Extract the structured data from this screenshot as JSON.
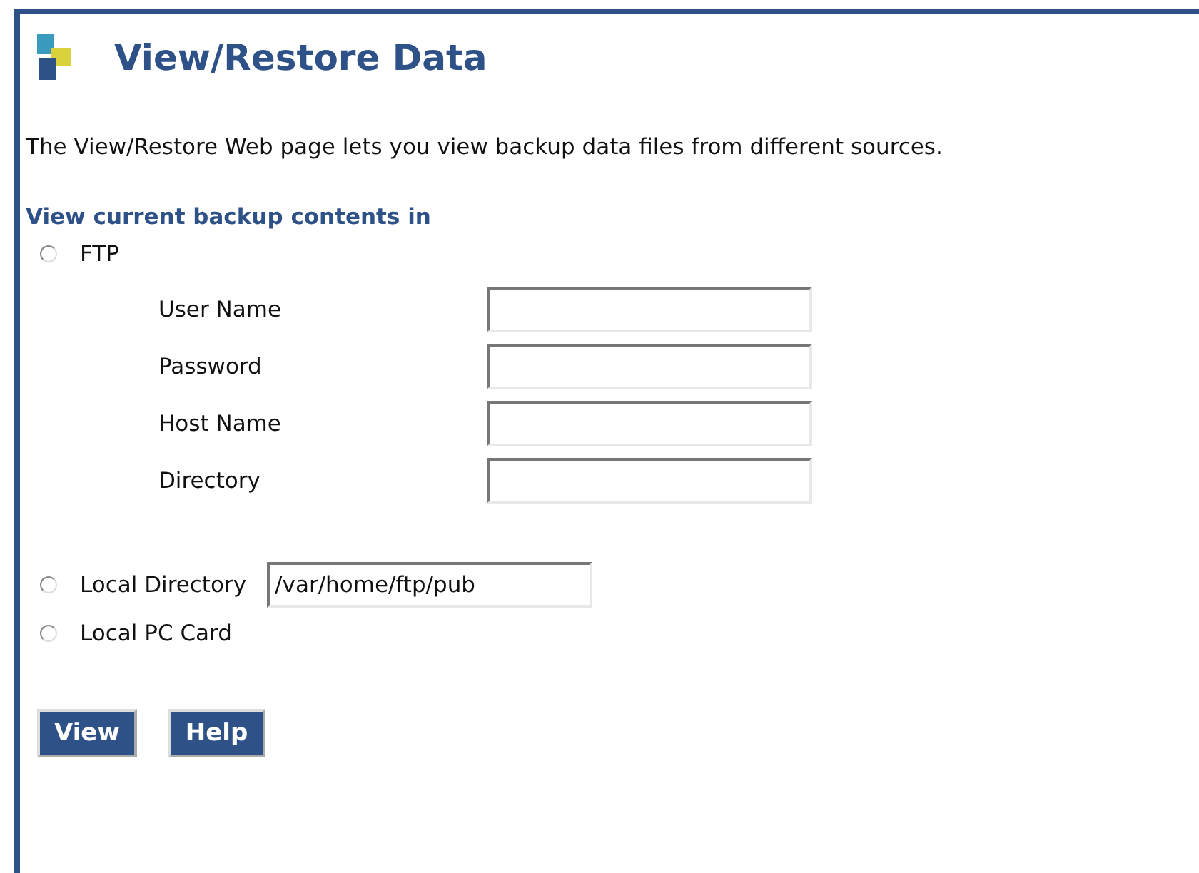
{
  "title": "View/Restore Data",
  "description": "The View/Restore Web page lets you view backup data files from different sources.",
  "section_heading": "View current backup contents in",
  "sources": [
    {
      "kind": "ftp",
      "label": "FTP",
      "selected": false,
      "fields": [
        {
          "label": "User Name"
        },
        {
          "label": "Password"
        },
        {
          "label": "Host Name"
        },
        {
          "label": "Directory"
        }
      ]
    },
    {
      "kind": "path",
      "label": "Local Directory",
      "selected": false,
      "value": "/var/home/ftp/pub"
    },
    {
      "kind": "plain",
      "label": "Local PC Card",
      "selected": false
    }
  ],
  "buttons": [
    "View",
    "Help"
  ]
}
